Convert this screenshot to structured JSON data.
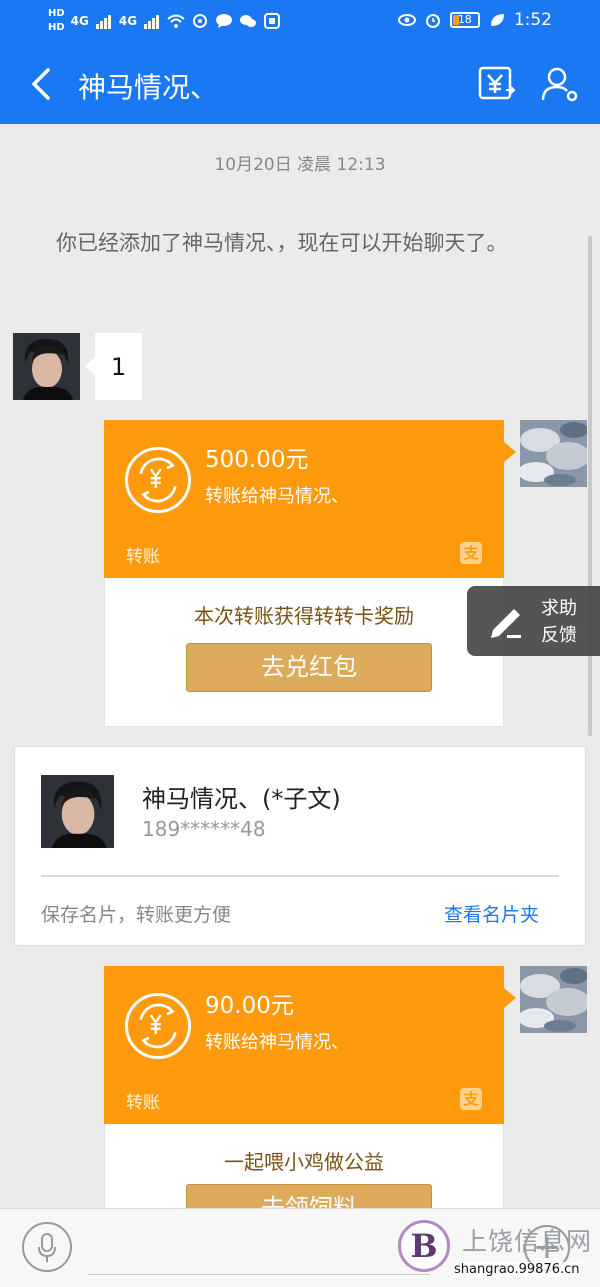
{
  "status_bar": {
    "hd_top": "HD",
    "hd_bottom": "HD",
    "signal_1": "4G",
    "signal_2": "4G",
    "battery_level": "18",
    "time": "1:52"
  },
  "header": {
    "title": "神马情况、",
    "accent_color": "#1a78f2"
  },
  "chat": {
    "timestamp": "10月20日 凌晨 12:13",
    "system_message": "你已经添加了神马情况、，现在可以开始聊天了。",
    "text_message": "1"
  },
  "transfers": [
    {
      "amount": "500.00元",
      "to": "转账给神马情况、",
      "label": "转账",
      "reward_text": "本次转账获得转转卡奖励",
      "button_label": "去兑红包"
    },
    {
      "amount": "90.00元",
      "to": "转账给神马情况、",
      "label": "转账",
      "reward_text": "一起喂小鸡做公益",
      "button_label": "去领饲料"
    }
  ],
  "feedback": {
    "line1": "求助",
    "line2": "反馈"
  },
  "name_card": {
    "name": "神马情况、(*子文)",
    "phone": "189******48",
    "save_hint": "保存名片，转账更方便",
    "view_link": "查看名片夹"
  },
  "input_bar": {
    "plus_symbol": "+"
  },
  "watermark": {
    "badge": "B",
    "site_name": "上饶信息网",
    "url": "shangrao.99876.cn"
  },
  "colors": {
    "transfer_orange": "#ff9a0c",
    "button_gold": "#ddaa5c",
    "link_blue": "#1a78f2"
  }
}
